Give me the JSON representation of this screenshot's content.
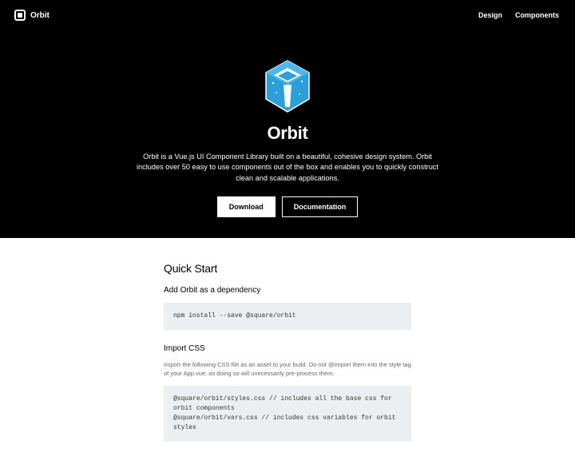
{
  "header": {
    "brand": "Orbit",
    "nav": {
      "design": "Design",
      "components": "Components"
    }
  },
  "hero": {
    "title": "Orbit",
    "description": "Orbit is a Vue.js UI Component Library built on a beautiful, cohesive design system. Orbit includes over 50 easy to use components out of the box and enables you to quickly construct clean and scalable applications.",
    "download_label": "Download",
    "docs_label": "Documentation"
  },
  "quickstart": {
    "title": "Quick Start",
    "dep_heading": "Add Orbit as a dependency",
    "dep_code": "npm install --save @square/orbit",
    "css_heading": "Import CSS",
    "css_note": "Import the following CSS file as an asset to your build. Do not @import them into the style tag of your App.vue, as doing so will unecessarily pre-process them.",
    "css_code": "@square/orbit/styles.css // includes all the base css for orbit components\n@square/orbit/vars.css // includes css variables for orbit styles"
  }
}
